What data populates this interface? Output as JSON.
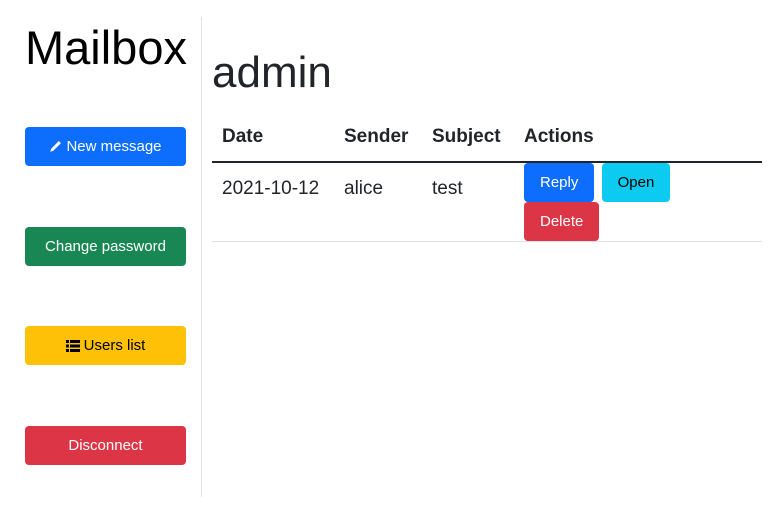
{
  "sidebar": {
    "title": "Mailbox",
    "buttons": [
      {
        "label": "New message",
        "icon": "pencil-icon",
        "color": "#0d6efd"
      },
      {
        "label": "Change password",
        "color": "#198754"
      },
      {
        "label": "Users list",
        "icon": "list-icon",
        "color": "#ffc107"
      },
      {
        "label": "Disconnect",
        "color": "#dc3545"
      }
    ]
  },
  "main": {
    "title": "admin",
    "table": {
      "headers": [
        "Date",
        "Sender",
        "Subject",
        "Actions"
      ],
      "rows": [
        {
          "date": "2021-10-12",
          "sender": "alice",
          "subject": "test",
          "actions": {
            "reply": "Reply",
            "open": "Open",
            "delete": "Delete"
          }
        }
      ]
    }
  },
  "colors": {
    "primary": "#0d6efd",
    "success": "#198754",
    "warning": "#ffc107",
    "danger": "#dc3545",
    "info": "#0dcaf0"
  }
}
